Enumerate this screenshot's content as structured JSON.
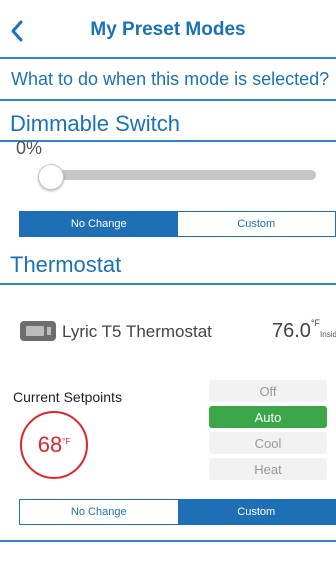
{
  "header": {
    "title": "My Preset Modes"
  },
  "question": "What to do when this mode is selected?",
  "dimmable": {
    "title": "Dimmable Switch",
    "value": "0%",
    "level": 0,
    "options": [
      {
        "label": "No Change",
        "selected": true
      },
      {
        "label": "Custom",
        "selected": false
      }
    ]
  },
  "thermostat": {
    "title": "Thermostat",
    "device": {
      "name": "Lyric T5 Thermostat",
      "temp": "76.0",
      "unit": "°F",
      "location": "Inside"
    },
    "setpoints_label": "Current Setpoints",
    "setpoint": {
      "value": "68",
      "unit": "°F"
    },
    "modes": [
      {
        "label": "Off",
        "selected": false
      },
      {
        "label": "Auto",
        "selected": true
      },
      {
        "label": "Cool",
        "selected": false
      },
      {
        "label": "Heat",
        "selected": false
      }
    ],
    "options": [
      {
        "label": "No Change",
        "selected": false
      },
      {
        "label": "Custom",
        "selected": true
      }
    ]
  },
  "colors": {
    "accent": "#1a72b8",
    "active_mode": "#3aa648",
    "setpoint": "#e0252b"
  },
  "icons": [
    "chevron-left-icon",
    "thermostat-icon"
  ]
}
